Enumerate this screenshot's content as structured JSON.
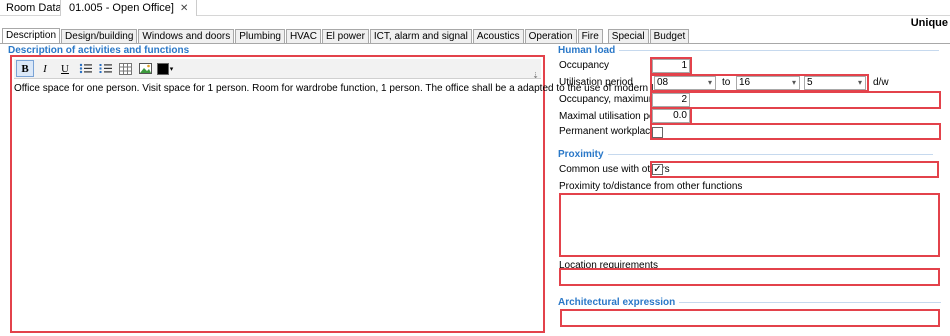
{
  "window": {
    "app_title": "Room Data",
    "doc_tab": "01.005 - Open Office]",
    "close_glyph": "✕",
    "mode_label": "Unique"
  },
  "tabs": [
    {
      "label": "Description",
      "active": true
    },
    {
      "label": "Design/building"
    },
    {
      "label": "Windows and doors"
    },
    {
      "label": "Plumbing"
    },
    {
      "label": "HVAC"
    },
    {
      "label": "El power"
    },
    {
      "label": "ICT, alarm and signal"
    },
    {
      "label": "Acoustics"
    },
    {
      "label": "Operation"
    },
    {
      "label": "Fire"
    },
    {
      "label": "Special"
    },
    {
      "label": "Budget"
    }
  ],
  "description": {
    "heading": "Description of activities and functions",
    "text": "Office space for one person. Visit space for 1 person. Room for wardrobe function, 1 person. The office shall be a adapted to the use of modern ICT tools.",
    "toolbar": {
      "bold": "B",
      "italic": "I",
      "underline": "U",
      "bullets_icon": "bulleted-list-icon",
      "numbered_icon": "numbered-list-icon",
      "table_icon": "table-icon",
      "image_icon": "image-icon",
      "color_value": "#000000",
      "dropdown_glyph": "▾"
    }
  },
  "human_load": {
    "heading": "Human load",
    "occupancy_label": "Occupancy",
    "occupancy_value": "1",
    "utilisation_label": "Utilisation period",
    "from_value": "08",
    "to_label": "to",
    "to_value": "16",
    "days_value": "5",
    "days_unit": "d/w",
    "occupancy_max_label": "Occupancy, maximum",
    "occupancy_max_value": "2",
    "max_util_label": "Maximal utilisation period",
    "max_util_value": "0.0",
    "permanent_label": "Permanent workplace",
    "permanent_checked": false
  },
  "proximity": {
    "heading": "Proximity",
    "common_use_label": "Common use with others",
    "common_use_checked": true,
    "check_glyph": "✓",
    "distance_label": "Proximity to/distance from other functions",
    "location_label": "Location requirements"
  },
  "architectural": {
    "heading": "Architectural  expression"
  },
  "colors": {
    "accent": "#2a78c8",
    "highlight": "#e3424b"
  }
}
